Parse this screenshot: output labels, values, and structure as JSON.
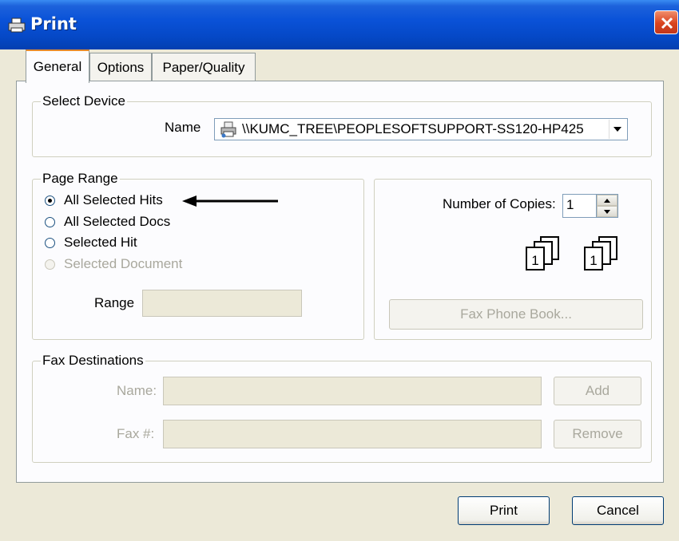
{
  "dialog": {
    "title": "Print"
  },
  "tabs": [
    {
      "label": "General"
    },
    {
      "label": "Options"
    },
    {
      "label": "Paper/Quality"
    }
  ],
  "select_device": {
    "legend": "Select Device",
    "name_label": "Name",
    "printer_value": "\\\\KUMC_TREE\\PEOPLESOFTSUPPORT-SS120-HP425"
  },
  "page_range": {
    "legend": "Page Range",
    "options": [
      {
        "label": "All Selected Hits",
        "checked": true,
        "enabled": true
      },
      {
        "label": "All Selected Docs",
        "checked": false,
        "enabled": true
      },
      {
        "label": "Selected Hit",
        "checked": false,
        "enabled": true
      },
      {
        "label": "Selected Document",
        "checked": false,
        "enabled": false
      }
    ],
    "range_label": "Range",
    "range_value": ""
  },
  "copies": {
    "label": "Number of Copies:",
    "value": "1",
    "collate_page_1": "1",
    "collate_page_2": "1",
    "fax_phone_book_label": "Fax Phone Book..."
  },
  "fax": {
    "legend": "Fax Destinations",
    "name_label": "Name:",
    "name_value": "",
    "fax_label": "Fax #:",
    "fax_value": "",
    "add_label": "Add",
    "remove_label": "Remove"
  },
  "footer": {
    "print_label": "Print",
    "cancel_label": "Cancel"
  },
  "colors": {
    "titlebar": "#0548c6",
    "dialog_bg": "#ece9d8",
    "panel_bg": "#fcfcfe",
    "close_red": "#d9431e",
    "disabled_text": "#a9a89d"
  },
  "icons": {
    "title": "printer-icon",
    "close": "close-icon",
    "device": "printer-icon",
    "dropdown": "chevron-down-icon",
    "annotation": "arrow-left-icon",
    "collate": "collate-copies-icon"
  }
}
